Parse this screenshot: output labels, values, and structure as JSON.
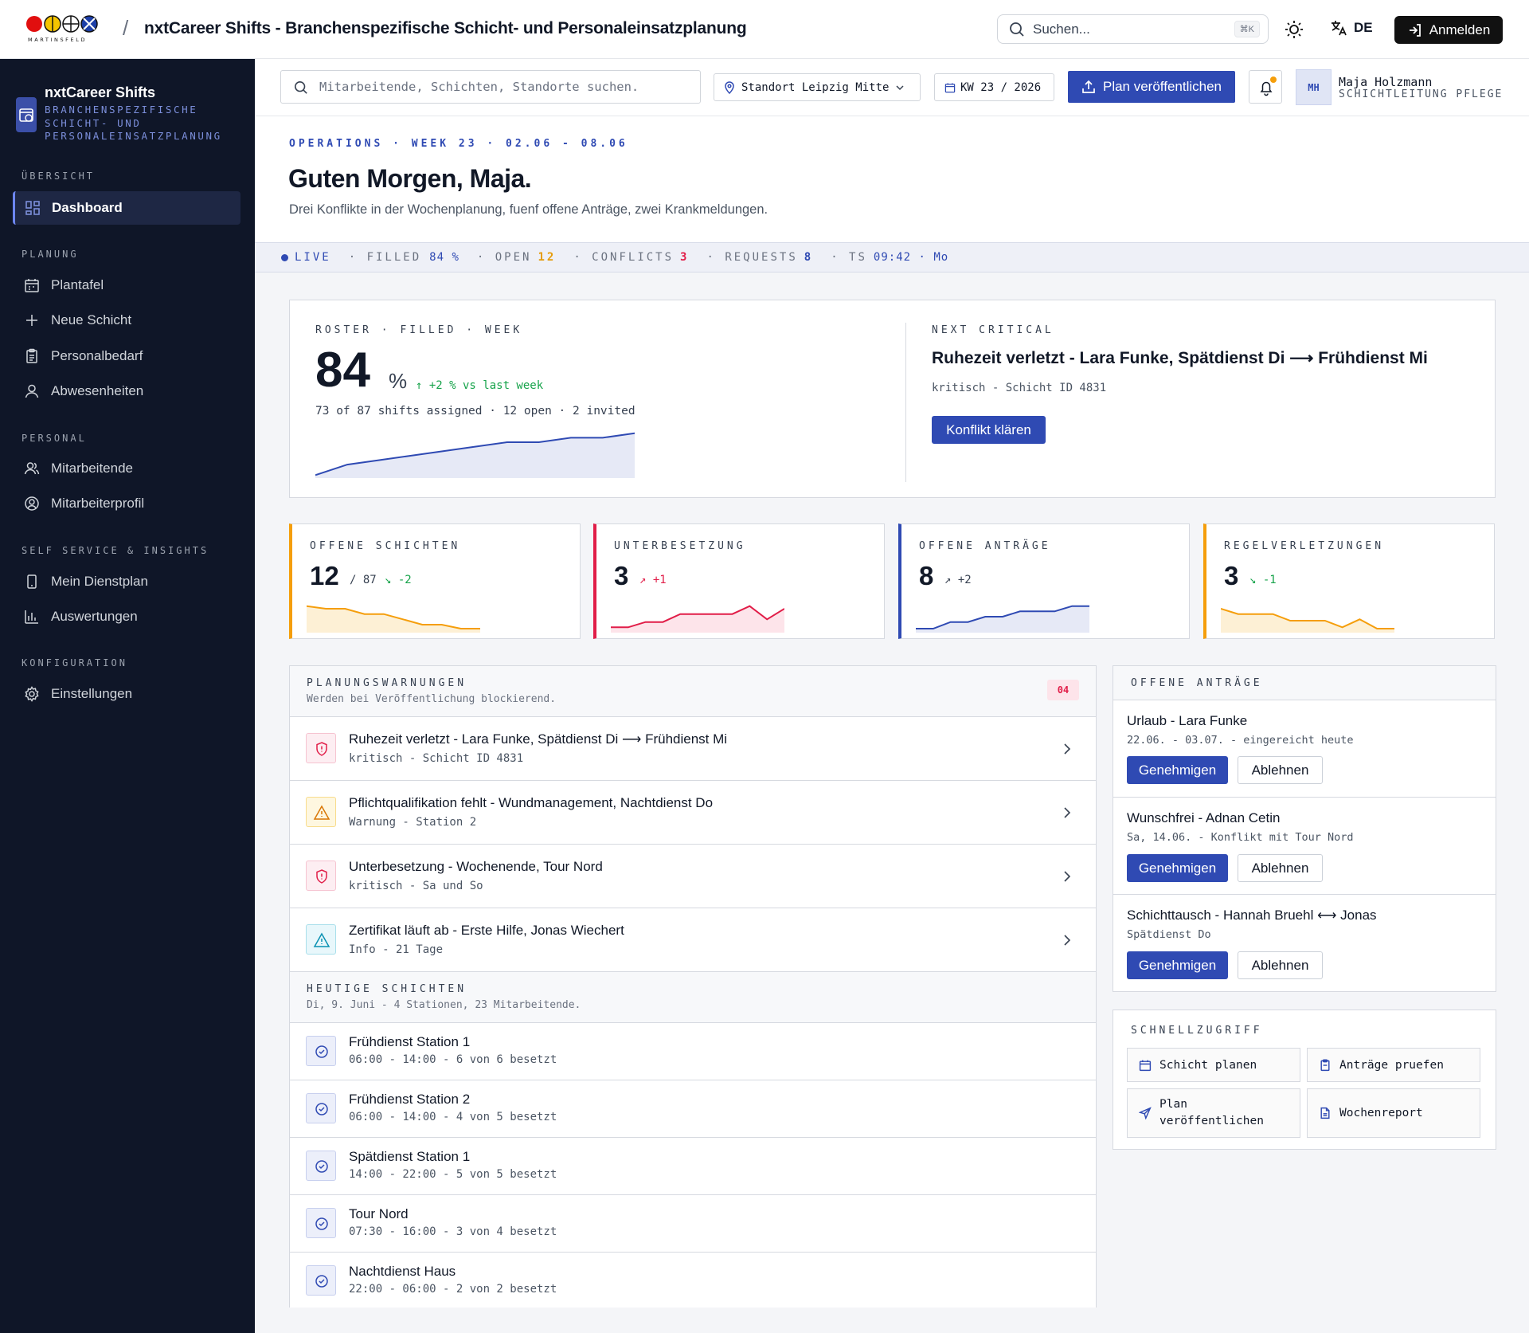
{
  "topbar": {
    "logo_text": "MARTINSFELD",
    "app_title": "nxtCareer Shifts - Branchenspezifische Schicht- und Personaleinsatzplanung",
    "search_placeholder": "Suchen...",
    "search_shortcut": "⌘K",
    "language": "DE",
    "login_label": "Anmelden"
  },
  "sidebar": {
    "brand_name": "nxtCareer Shifts",
    "brand_sub": "BRANCHENSPEZIFISCHE SCHICHT- UND PERSONALEINSATZPLANUNG",
    "sections": [
      {
        "label": "ÜBERSICHT",
        "items": [
          {
            "label": "Dashboard",
            "icon": "dashboard-icon",
            "active": true
          }
        ]
      },
      {
        "label": "PLANUNG",
        "items": [
          {
            "label": "Plantafel",
            "icon": "calendar-icon"
          },
          {
            "label": "Neue Schicht",
            "icon": "plus-icon"
          },
          {
            "label": "Personalbedarf",
            "icon": "clipboard-icon"
          },
          {
            "label": "Abwesenheiten",
            "icon": "user-icon"
          }
        ]
      },
      {
        "label": "PERSONAL",
        "items": [
          {
            "label": "Mitarbeitende",
            "icon": "users-icon"
          },
          {
            "label": "Mitarbeiterprofil",
            "icon": "user-circle-icon"
          }
        ]
      },
      {
        "label": "SELF SERVICE & INSIGHTS",
        "items": [
          {
            "label": "Mein Dienstplan",
            "icon": "phone-icon"
          },
          {
            "label": "Auswertungen",
            "icon": "bar-chart-icon"
          }
        ]
      },
      {
        "label": "KONFIGURATION",
        "items": [
          {
            "label": "Einstellungen",
            "icon": "gear-icon"
          }
        ]
      }
    ]
  },
  "subbar": {
    "search_placeholder": "Mitarbeitende, Schichten, Standorte suchen.",
    "location": "Standort Leipzig Mitte",
    "week": "KW 23 / 2026",
    "publish_label": "Plan veröffentlichen",
    "user_initials": "MH",
    "user_name": "Maja Holzmann",
    "user_role": "SCHICHTLEITUNG PFLEGE"
  },
  "greeting": {
    "breadcrumb": "OPERATIONS · WEEK 23 · 02.06 - 08.06",
    "title": "Guten Morgen, Maja.",
    "subtitle": "Drei Konflikte in der Wochenplanung, fuenf offene Anträge, zwei Krankmeldungen."
  },
  "status": {
    "live": "LIVE",
    "filled_label": "· FILLED",
    "filled_value": "84 %",
    "open_label": "· OPEN",
    "open_value": "12",
    "conflicts_label": "· CONFLICTS",
    "conflicts_value": "3",
    "requests_label": "· REQUESTS",
    "requests_value": "8",
    "ts_label": "· TS",
    "ts_value": "09:42 · Mo"
  },
  "roster": {
    "label": "ROSTER · FILLED · WEEK",
    "value": "84",
    "unit": "%",
    "delta": "↑ +2 % vs last week",
    "detail": "73 of 87 shifts assigned · 12 open · 2 invited",
    "trend": [
      50,
      57,
      60,
      63,
      66,
      69,
      72,
      72,
      75,
      75,
      78
    ]
  },
  "critical": {
    "label": "NEXT CRITICAL",
    "title": "Ruhezeit verletzt - Lara Funke, Spätdienst Di ⟶ Frühdienst Mi",
    "meta": "kritisch - Schicht ID 4831",
    "action": "Konflikt klären"
  },
  "kpis": [
    {
      "label": "OFFENE SCHICHTEN",
      "value": "12",
      "suffix": "/ 87",
      "delta": "↘ -2",
      "color": "#f59e0b",
      "trend": [
        72,
        70,
        70,
        66,
        66,
        62,
        58,
        58,
        55,
        55
      ]
    },
    {
      "label": "UNTERBESETZUNG",
      "value": "3",
      "suffix": "",
      "delta": "↗ +1",
      "color": "#e11d48",
      "trend": [
        56,
        56,
        60,
        60,
        66,
        66,
        66,
        66,
        72,
        62,
        70
      ]
    },
    {
      "label": "OFFENE ANTRÄGE",
      "value": "8",
      "suffix": "",
      "delta": "↗ +2",
      "color": "#2f4ab3",
      "trend": [
        55,
        55,
        60,
        60,
        64,
        64,
        68,
        68,
        68,
        72,
        72
      ]
    },
    {
      "label": "REGELVERLETZUNGEN",
      "value": "3",
      "suffix": "",
      "delta": "↘ -1",
      "color": "#f59e0b",
      "trend": [
        70,
        66,
        66,
        66,
        61,
        61,
        61,
        56,
        62,
        55,
        55
      ]
    }
  ],
  "warnings": {
    "label": "PLANUNGSWARNUNGEN",
    "sub": "Werden bei Veröffentlichung blockierend.",
    "badge": "04",
    "items": [
      {
        "title": "Ruhezeit verletzt - Lara Funke, Spätdienst Di ⟶ Frühdienst Mi",
        "meta": "kritisch - Schicht ID 4831",
        "level": "critical"
      },
      {
        "title": "Pflichtqualifikation fehlt - Wundmanagement, Nachtdienst Do",
        "meta": "Warnung - Station 2",
        "level": "warning"
      },
      {
        "title": "Unterbesetzung - Wochenende, Tour Nord",
        "meta": "kritisch - Sa und So",
        "level": "critical"
      },
      {
        "title": "Zertifikat läuft ab - Erste Hilfe, Jonas Wiechert",
        "meta": "Info - 21 Tage",
        "level": "info"
      }
    ]
  },
  "shifts": {
    "label": "HEUTIGE SCHICHTEN",
    "sub": "Di, 9. Juni - 4 Stationen, 23 Mitarbeitende.",
    "items": [
      {
        "title": "Frühdienst Station 1",
        "meta": "06:00 - 14:00 - 6 von 6 besetzt"
      },
      {
        "title": "Frühdienst Station 2",
        "meta": "06:00 - 14:00 - 4 von 5 besetzt"
      },
      {
        "title": "Spätdienst Station 1",
        "meta": "14:00 - 22:00 - 5 von 5 besetzt"
      },
      {
        "title": "Tour Nord",
        "meta": "07:30 - 16:00 - 3 von 4 besetzt"
      },
      {
        "title": "Nachtdienst Haus",
        "meta": "22:00 - 06:00 - 2 von 2 besetzt"
      }
    ]
  },
  "requests": {
    "label": "OFFENE ANTRÄGE",
    "approve": "Genehmigen",
    "reject": "Ablehnen",
    "items": [
      {
        "title": "Urlaub - Lara Funke",
        "meta": "22.06. - 03.07. - eingereicht heute"
      },
      {
        "title": "Wunschfrei - Adnan Cetin",
        "meta": "Sa, 14.06. - Konflikt mit Tour Nord"
      },
      {
        "title": "Schichttausch - Hannah Bruehl ⟷ Jonas",
        "meta": "Spätdienst Do"
      }
    ]
  },
  "quick": {
    "label": "SCHNELLZUGRIFF",
    "items": [
      {
        "label": "Schicht planen",
        "icon": "calendar-icon"
      },
      {
        "label": "Anträge pruefen",
        "icon": "clipboard-icon"
      },
      {
        "label": "Plan veröffentlichen",
        "icon": "send-icon"
      },
      {
        "label": "Wochenreport",
        "icon": "document-icon"
      }
    ]
  }
}
